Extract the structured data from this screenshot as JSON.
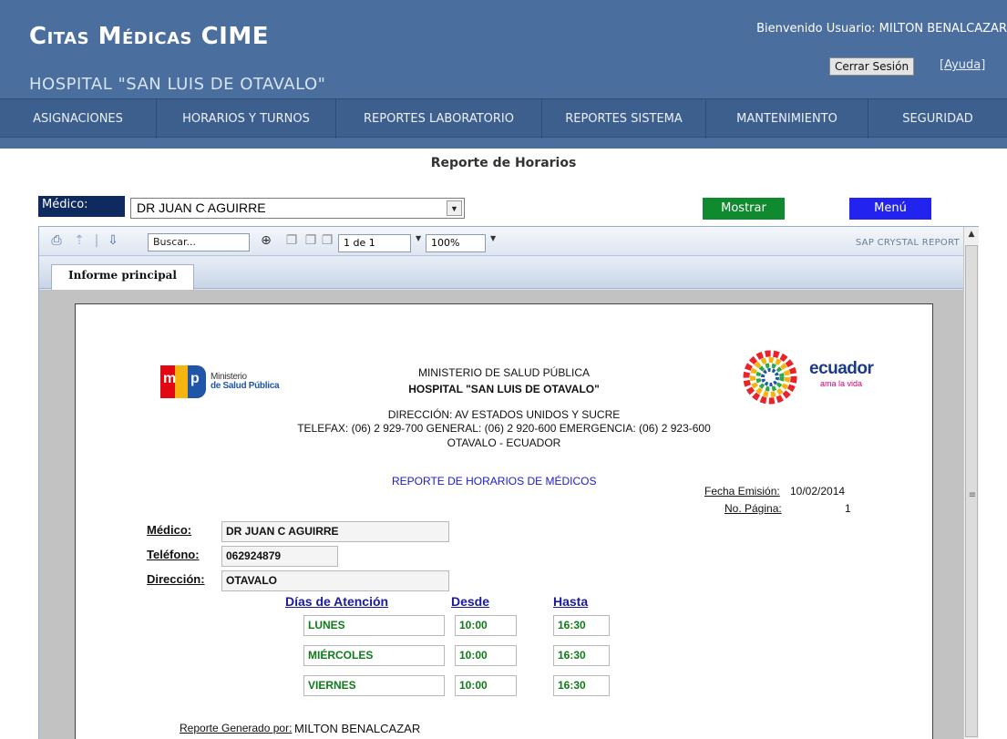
{
  "header": {
    "brand": "Citas Médicas CIME",
    "hospital": "HOSPITAL \"SAN LUIS DE OTAVALO\"",
    "welcome": "Bienvenido Usuario: MILTON BENALCAZAR",
    "logout_label": "Cerrar Sesión",
    "help_label": "[Ayuda]"
  },
  "nav": {
    "items": [
      {
        "label": "ASIGNACIONES"
      },
      {
        "label": "HORARIOS Y TURNOS"
      },
      {
        "label": "REPORTES LABORATORIO"
      },
      {
        "label": "REPORTES SISTEMA"
      },
      {
        "label": "MANTENIMIENTO"
      },
      {
        "label": "SEGURIDAD"
      }
    ]
  },
  "page_title": "Reporte de Horarios",
  "selector": {
    "label": "Médico:",
    "value": "DR JUAN C AGUIRRE",
    "mostrar_label": "Mostrar",
    "menu_label": "Menú"
  },
  "viewer": {
    "search_value": "Buscar...",
    "page_value": "1 de 1",
    "zoom_value": "100%",
    "brand": "SAP CRYSTAL REPORT",
    "tab_label": "Informe principal"
  },
  "report": {
    "msp_logo_m": "m",
    "msp_logo_p": "p",
    "msp_text_1": "Ministerio",
    "msp_text_2": "de Salud Pública",
    "ec_word": "ecuador",
    "ec_tag": "ama la vida",
    "ministry": "MINISTERIO DE SALUD PÚBLICA",
    "hospital": "HOSPITAL \"SAN LUIS DE OTAVALO\"",
    "address": "DIRECCIÓN: AV ESTADOS UNIDOS Y SUCRE",
    "phones": "TELEFAX: (06) 2 929-700   GENERAL: (06) 2 920-600   EMERGENCIA: (06) 2 923-600",
    "city": "OTAVALO - ECUADOR",
    "heading": "REPORTE  DE HORARIOS DE MÉDICOS",
    "fecha_label": "Fecha Emisión:",
    "fecha_value": "10/02/2014",
    "pagina_label": "No. Página:",
    "pagina_value": "1",
    "medico_label": "Médico:",
    "medico_value": "DR JUAN C AGUIRRE",
    "telefono_label": "Teléfono:",
    "telefono_value": "062924879",
    "direccion_label": "Dirección:",
    "direccion_value": "OTAVALO",
    "col_dias": "Días de Atención",
    "col_desde": "Desde",
    "col_hasta": "Hasta",
    "schedule": [
      {
        "dia": "LUNES",
        "desde": "10:00",
        "hasta": "16:30"
      },
      {
        "dia": "MIÉRCOLES",
        "desde": "10:00",
        "hasta": "16:30"
      },
      {
        "dia": "VIERNES",
        "desde": "10:00",
        "hasta": "16:30"
      }
    ],
    "generated_label": "Reporte Generado por:",
    "generated_value": "MILTON BENALCAZAR"
  },
  "colors": {
    "header_bg": "#4a6e9e",
    "nav_bg": "#3d5f8e",
    "mostrar_bg": "#0f8a2f",
    "menu_bg": "#2323f0",
    "schedule_text": "#0f7a1a"
  }
}
